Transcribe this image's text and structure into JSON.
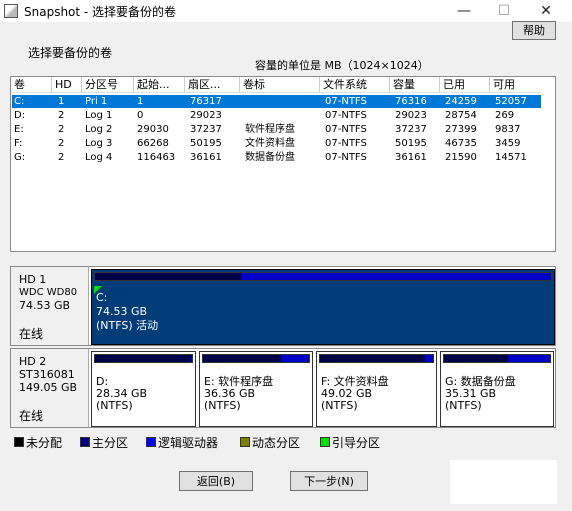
{
  "window": {
    "title": "Snapshot - 选择要备份的卷",
    "min": "—",
    "max": "☐",
    "close": "✕"
  },
  "help_label": "帮助",
  "section_label": "选择要备份的卷",
  "unit_label": "容量的单位是 MB（1024×1024）",
  "table": {
    "headers": [
      "卷",
      "HD",
      "分区号",
      "起始...",
      "扇区...",
      "卷标",
      "文件系统",
      "容量",
      "已用",
      "可用"
    ],
    "rows": [
      [
        "C:",
        "1",
        "Pri 1",
        "1",
        "76317",
        "",
        "07-NTFS",
        "76316",
        "24259",
        "52057"
      ],
      [
        "D:",
        "2",
        "Log 1",
        "0",
        "29023",
        "",
        "07-NTFS",
        "29023",
        "28754",
        "269"
      ],
      [
        "E:",
        "2",
        "Log 2",
        "29030",
        "37237",
        "软件程序盘",
        "07-NTFS",
        "37237",
        "27399",
        "9837"
      ],
      [
        "F:",
        "2",
        "Log 3",
        "66268",
        "50195",
        "文件资料盘",
        "07-NTFS",
        "50195",
        "46735",
        "3459"
      ],
      [
        "G:",
        "2",
        "Log 4",
        "116463",
        "36161",
        "数据备份盘",
        "07-NTFS",
        "36161",
        "21590",
        "14571"
      ]
    ]
  },
  "disks": [
    {
      "name": "HD 1",
      "model": "WDC WD80",
      "size": "74.53 GB",
      "status": "在线",
      "partitions": [
        {
          "line1": "C:",
          "line2": "74.53 GB",
          "line3": "(NTFS) 活动",
          "used_fraction": 0.32,
          "color": "#003c78"
        }
      ]
    },
    {
      "name": "HD 2",
      "model": "ST316081",
      "size": "149.05 GB",
      "status": "在线",
      "partitions": [
        {
          "line1": "D:",
          "line2": "28.34 GB",
          "line3": "(NTFS)",
          "used_fraction": 0.99
        },
        {
          "line1": "E: 软件程序盘",
          "line2": "36.36 GB",
          "line3": "(NTFS)",
          "used_fraction": 0.74
        },
        {
          "line1": "F: 文件资料盘",
          "line2": "49.02 GB",
          "line3": "(NTFS)",
          "used_fraction": 0.93
        },
        {
          "line1": "G: 数据备份盘",
          "line2": "35.31 GB",
          "line3": "(NTFS)",
          "used_fraction": 0.6
        }
      ]
    }
  ],
  "legend": [
    {
      "label": "未分配",
      "color": "#000000"
    },
    {
      "label": "主分区",
      "color": "#00007a"
    },
    {
      "label": "逻辑驱动器",
      "color": "#0000ff"
    },
    {
      "label": "动态分区",
      "color": "#808000"
    },
    {
      "label": "引导分区",
      "color": "#00e000"
    }
  ],
  "buttons": {
    "back": "返回(B)",
    "next": "下一步(N)"
  }
}
